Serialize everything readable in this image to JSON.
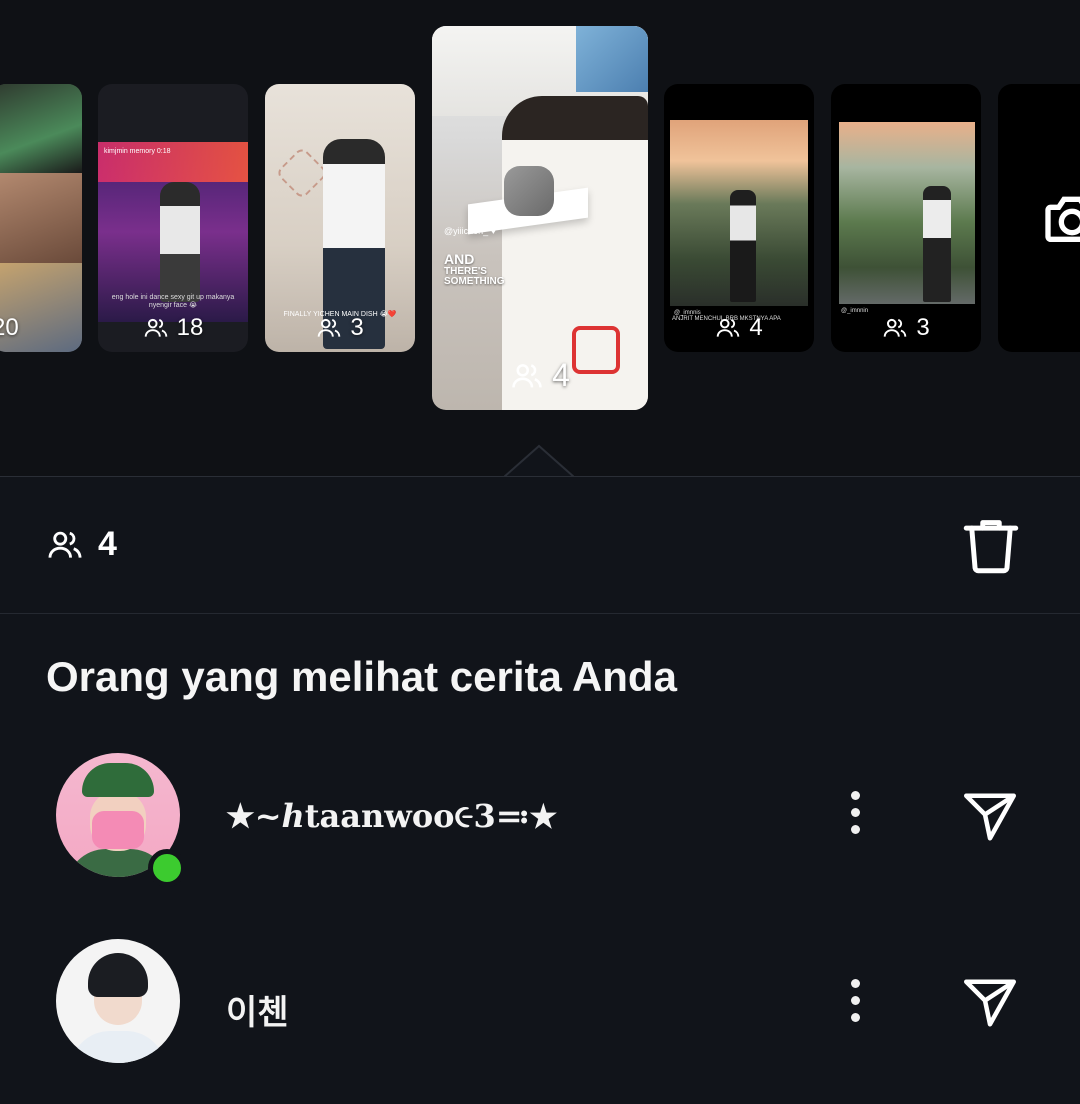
{
  "stories": [
    {
      "views": "20",
      "caption": ""
    },
    {
      "views": "18",
      "caption_top": "kimjmin memory  0:18",
      "caption": "eng hole ini dance sexy git up makanya nyengir face 😭"
    },
    {
      "views": "3",
      "caption": "FINALLY YICHEN MAIN DISH 😭❤️"
    },
    {
      "views": "4",
      "mention": "@yiiichen_ ♥",
      "headline_1": "AND",
      "headline_2": "THERE'S",
      "headline_3": "SOMETHING"
    },
    {
      "views": "4",
      "caption_top": "@_imnnis",
      "caption": "ANJRIT MENCHUL BRB MKSTNYA APA"
    },
    {
      "views": "3",
      "caption_top": "@_imnnin"
    }
  ],
  "viewer_bar": {
    "count": "4",
    "icons": {
      "viewers": "people-icon",
      "delete": "trash-icon"
    }
  },
  "heading": "Orang yang melihat cerita Anda",
  "viewers": [
    {
      "name": "★~ℎtaanwoo૯3≕★",
      "online": true,
      "icons": {
        "more": "more-vertical-icon",
        "send": "send-icon"
      }
    },
    {
      "name": "이첸",
      "online": false,
      "icons": {
        "more": "more-vertical-icon",
        "send": "send-icon"
      }
    }
  ],
  "colors": {
    "background": "#0c0f14",
    "panel": "#11141a",
    "text": "#ffffff",
    "online": "#3ccb2f"
  }
}
